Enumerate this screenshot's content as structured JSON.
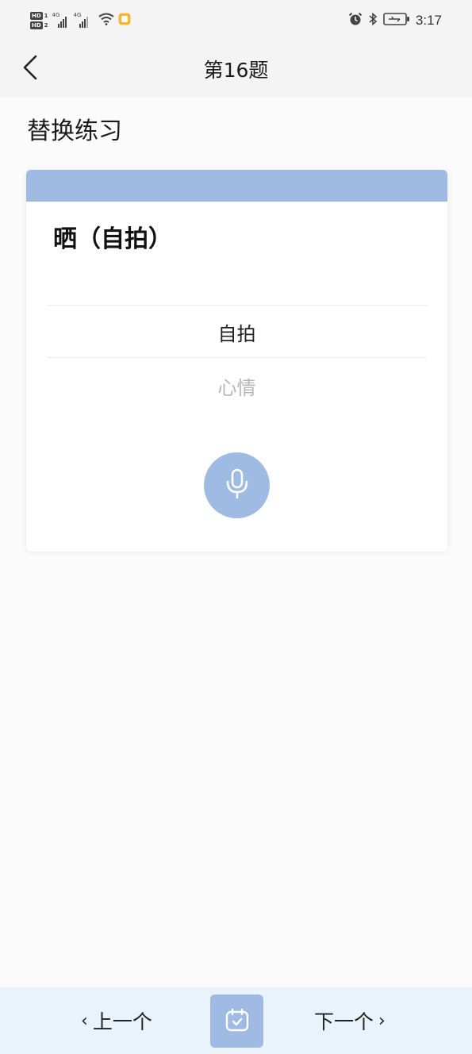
{
  "status_bar": {
    "time": "3:17",
    "left_badges": [
      "HD",
      "HD"
    ],
    "sim_numbers": [
      "1",
      "2"
    ],
    "network_labels": [
      "4G",
      "4G"
    ],
    "icons": [
      "signal-icon",
      "signal-icon",
      "wifi-icon",
      "app-notification-icon",
      "alarm-icon",
      "bluetooth-icon",
      "battery-charging-icon"
    ]
  },
  "header": {
    "title": "第16题",
    "back_icon": "chevron-left-icon"
  },
  "section_title": "替换练习",
  "card": {
    "question": "晒（自拍）",
    "options": [
      "自拍",
      "心情"
    ],
    "mic_icon": "microphone-icon",
    "accent_color": "#9fbbe4"
  },
  "bottom_bar": {
    "prev_label": "上一个",
    "next_label": "下一个",
    "center_icon": "calendar-check-icon",
    "background_color": "#e9f3fb"
  }
}
